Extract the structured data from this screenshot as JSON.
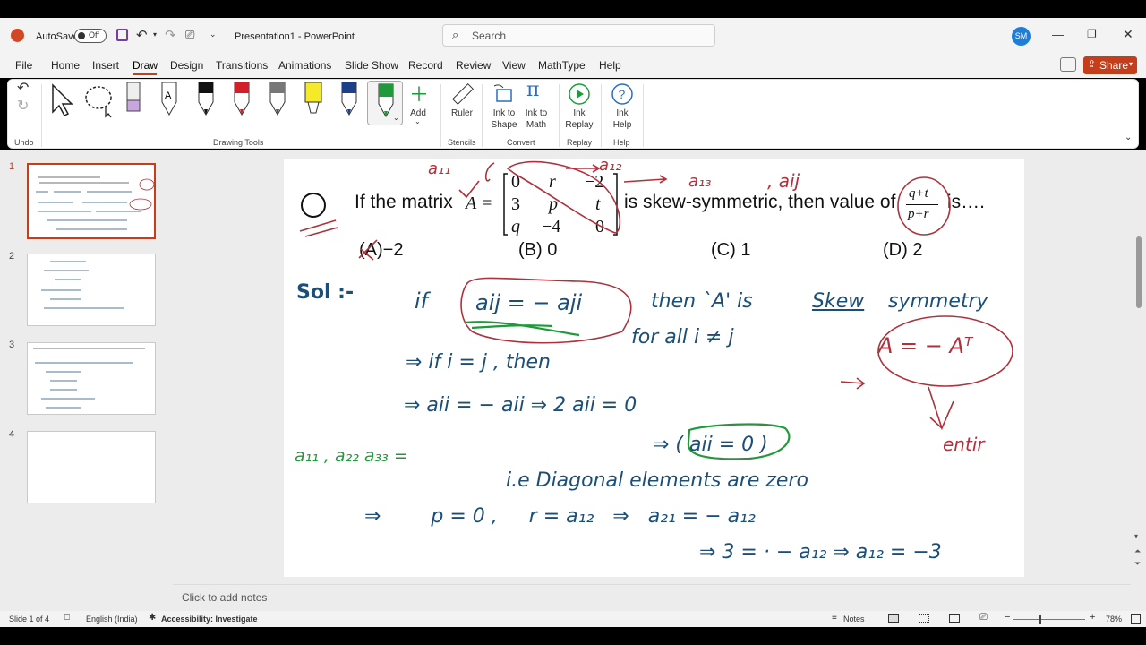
{
  "titlebar": {
    "autosave_label": "AutoSave",
    "autosave_state": "Off",
    "doc_title": "Presentation1  -  PowerPoint",
    "search_placeholder": "Search",
    "user_initials": "SM"
  },
  "menu": {
    "tabs": [
      "File",
      "Home",
      "Insert",
      "Draw",
      "Design",
      "Transitions",
      "Animations",
      "Slide Show",
      "Record",
      "Review",
      "View",
      "MathType",
      "Help"
    ],
    "active": "Draw",
    "share_label": "Share"
  },
  "ribbon": {
    "groups": {
      "undo": "Undo",
      "drawing_tools": "Drawing Tools",
      "stencils": "Stencils",
      "convert": "Convert",
      "replay": "Replay",
      "help": "Help"
    },
    "add_label": "Add",
    "ruler_label": "Ruler",
    "ink_to_shape_1": "Ink to",
    "ink_to_shape_2": "Shape",
    "ink_to_math_1": "Ink to",
    "ink_to_math_2": "Math",
    "ink_replay_1": "Ink",
    "ink_replay_2": "Replay",
    "ink_help_1": "Ink",
    "ink_help_2": "Help"
  },
  "thumbnails": {
    "numbers": [
      "1",
      "2",
      "3",
      "4"
    ]
  },
  "slide": {
    "question_prefix": "If the matrix",
    "matrix_var": "A =",
    "matrix": [
      [
        "0",
        "r",
        "−2"
      ],
      [
        "3",
        "p",
        "t"
      ],
      [
        "q",
        "−4",
        "0"
      ]
    ],
    "question_mid": "is skew-symmetric, then value of",
    "fraction_num": "q+t",
    "fraction_den": "p+r",
    "question_suffix": "is….",
    "options": [
      "(A)−2",
      "(B) 0",
      "(C) 1",
      "(D) 2"
    ],
    "ink": {
      "q_circle": "Q",
      "a11": "a₁₁",
      "a12": "a₁₂",
      "a13": "a₁₃",
      "aij_top": ", aij",
      "sol": "Sol :-",
      "line1a": "if",
      "line1b": "aij = − aji",
      "line1c": "then `A' is",
      "line1d": "Skew",
      "line1e": "symmetry",
      "line2": "for all   i ≠ j",
      "line3": "⇒ if   i = j  ,  then",
      "line4": "⇒    aii = − aii  ⇒  2 aii  = 0",
      "line5": "⇒ ( aii = 0 )",
      "a_eq": "A = − Aᵀ",
      "entir": "entir",
      "green_left": "a₁₁ , a₂₂  a₃₃ =",
      "line6": "i.e  Diagonal  elements  are  zero",
      "line7": "⇒        p = 0 ,     r = a₁₂   ⇒   a₂₁ = − a₁₂",
      "line8": "⇒    3 = · − a₁₂  ⇒  a₁₂ = −3",
      "arrow_right": "⇒"
    }
  },
  "notes_placeholder": "Click to add notes",
  "status": {
    "slide_of": "Slide 1 of 4",
    "language": "English (India)",
    "accessibility": "Accessibility: Investigate",
    "notes": "Notes",
    "zoom": "78%"
  },
  "colors": {
    "accent": "#c43e1c",
    "ink_blue": "#1b4f7a",
    "ink_red": "#b0303b",
    "ink_green": "#1f9a3a"
  }
}
